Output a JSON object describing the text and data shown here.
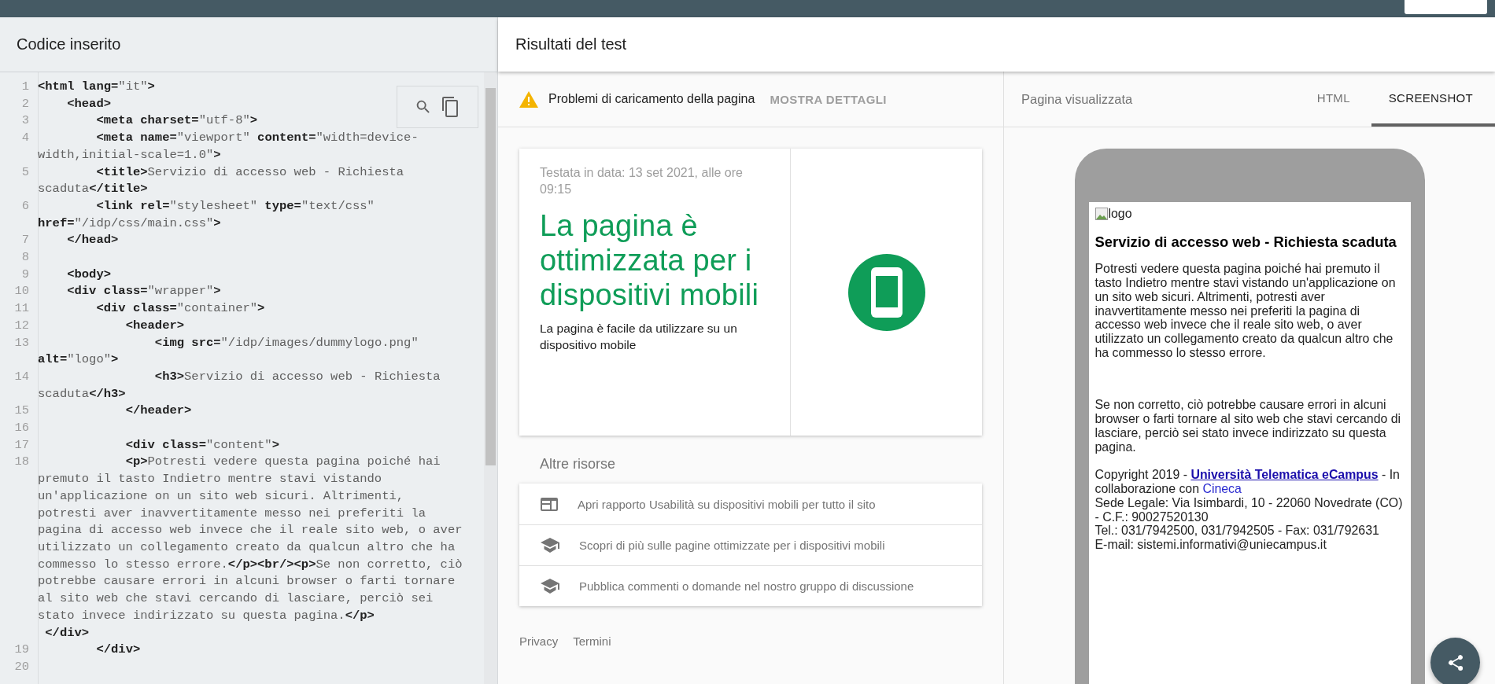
{
  "code_panel": {
    "title": "Codice inserito",
    "lines": [
      {
        "number": "1",
        "text": "**<html lang=**\"it\"**>**"
      },
      {
        "number": "2",
        "text": "    **<head>**"
      },
      {
        "number": "3",
        "text": "        **<meta charset=**\"utf-8\"**>**"
      },
      {
        "number": "4",
        "text": "        **<meta name=**\"viewport\" **content=**\"width=device-width,initial-scale=1.0\"**>**"
      },
      {
        "number": "5",
        "text": "        **<title>**Servizio di accesso web - Richiesta scaduta**</title>**"
      },
      {
        "number": "6",
        "text": "        **<link rel=**\"stylesheet\" **type=**\"text/css\" **href=**\"/idp/css/main.css\"**>**"
      },
      {
        "number": "7",
        "text": "    **</head>**"
      },
      {
        "number": "8"
      },
      {
        "number": "9",
        "text": "    **<body>**"
      },
      {
        "number": "10",
        "text": "    **<div class=**\"wrapper\"**>**"
      },
      {
        "number": "11",
        "text": "        **<div class=**\"container\"**>**"
      },
      {
        "number": "12",
        "text": "            **<header>**"
      },
      {
        "number": "13",
        "text": "                **<img src=**\"/idp/images/dummylogo.png\" **alt=**\"logo\"**>**"
      },
      {
        "number": "14",
        "text": "                **<h3>**Servizio di accesso web - Richiesta scaduta**</h3>**"
      },
      {
        "number": "15",
        "text": "            **</header>**"
      },
      {
        "number": "16"
      },
      {
        "number": "17",
        "text": "            **<div class=**\"content\"**>**"
      },
      {
        "number": "18",
        "text": "            **<p>**Potresti vedere questa pagina poiché hai premuto il tasto Indietro mentre stavi vistando un'applicazione on un sito web sicuri. Altrimenti, potresti aver inavvertitamente messo nei preferiti la pagina di accesso web invece che il reale sito web, o aver utilizzato un collegamento creato da qualcun altro che ha commesso lo stesso errore.**</p><br/><p>**Se non corretto, ciò potrebbe causare errori in alcuni browser o farti tornare al sito web che stavi cercando di lasciare, perciò sei stato invece indirizzato su questa pagina.**</p>**"
      },
      {
        "text": " **</div>**"
      },
      {
        "number": "19",
        "text": "        **</div>**"
      },
      {
        "number": "20"
      }
    ]
  },
  "results": {
    "title": "Risultati del test",
    "warning": {
      "text": "Problemi di caricamento della pagina",
      "action": "MOSTRA DETTAGLI"
    },
    "verdict": {
      "tested": "Testata in data: 13 set 2021, alle ore 09:15",
      "headline": "La pagina è ottimizzata per i dispositivi mobili",
      "description": "La pagina è facile da utilizzare su un dispositivo mobile"
    },
    "resources_title": "Altre risorse",
    "resources": [
      {
        "kind": "report",
        "text": "Apri rapporto Usabilità su dispositivi mobili per tutto il sito"
      },
      {
        "kind": "learn",
        "text": "Scopri di più sulle pagine ottimizzate per i dispositivi mobili"
      },
      {
        "kind": "learn",
        "text": "Pubblica commenti o domande nel nostro gruppo di discussione"
      }
    ],
    "footer_links": [
      "Privacy",
      "Termini"
    ]
  },
  "rendered": {
    "title": "Pagina visualizzata",
    "tabs": [
      {
        "label": "HTML",
        "selected": false
      },
      {
        "label": "SCREENSHOT",
        "selected": true
      }
    ],
    "page": {
      "logo_alt": "logo",
      "heading": "Servizio di accesso web - Richiesta scaduta",
      "paragraphs": [
        "Potresti vedere questa pagina poiché hai premuto il tasto Indietro mentre stavi vistando un'applicazione on un sito web sicuri. Altrimenti, potresti aver inavvertitamente messo nei preferiti la pagina di accesso web invece che il reale sito web, o aver utilizzato un collegamento creato da qualcun altro che ha commesso lo stesso errore.",
        "Se non corretto, ciò potrebbe causare errori in alcuni browser o farti tornare al sito web che stavi cercando di lasciare, perciò sei stato invece indirizzato su questa pagina."
      ],
      "copyright": {
        "prefix": "Copyright 2019 -",
        "link": "Università Telematica eCampus",
        "middle": "- In collaborazione con",
        "partner": "Cineca"
      },
      "contact_lines": [
        "Sede Legale: Via Isimbardi, 10 - 22060 Novedrate (CO) - C.F.: 90027520130",
        "Tel.: 031/7942500, 031/7942505 - Fax: 031/792631",
        "E-mail: sistemi.informativi@uniecampus.it"
      ]
    }
  }
}
